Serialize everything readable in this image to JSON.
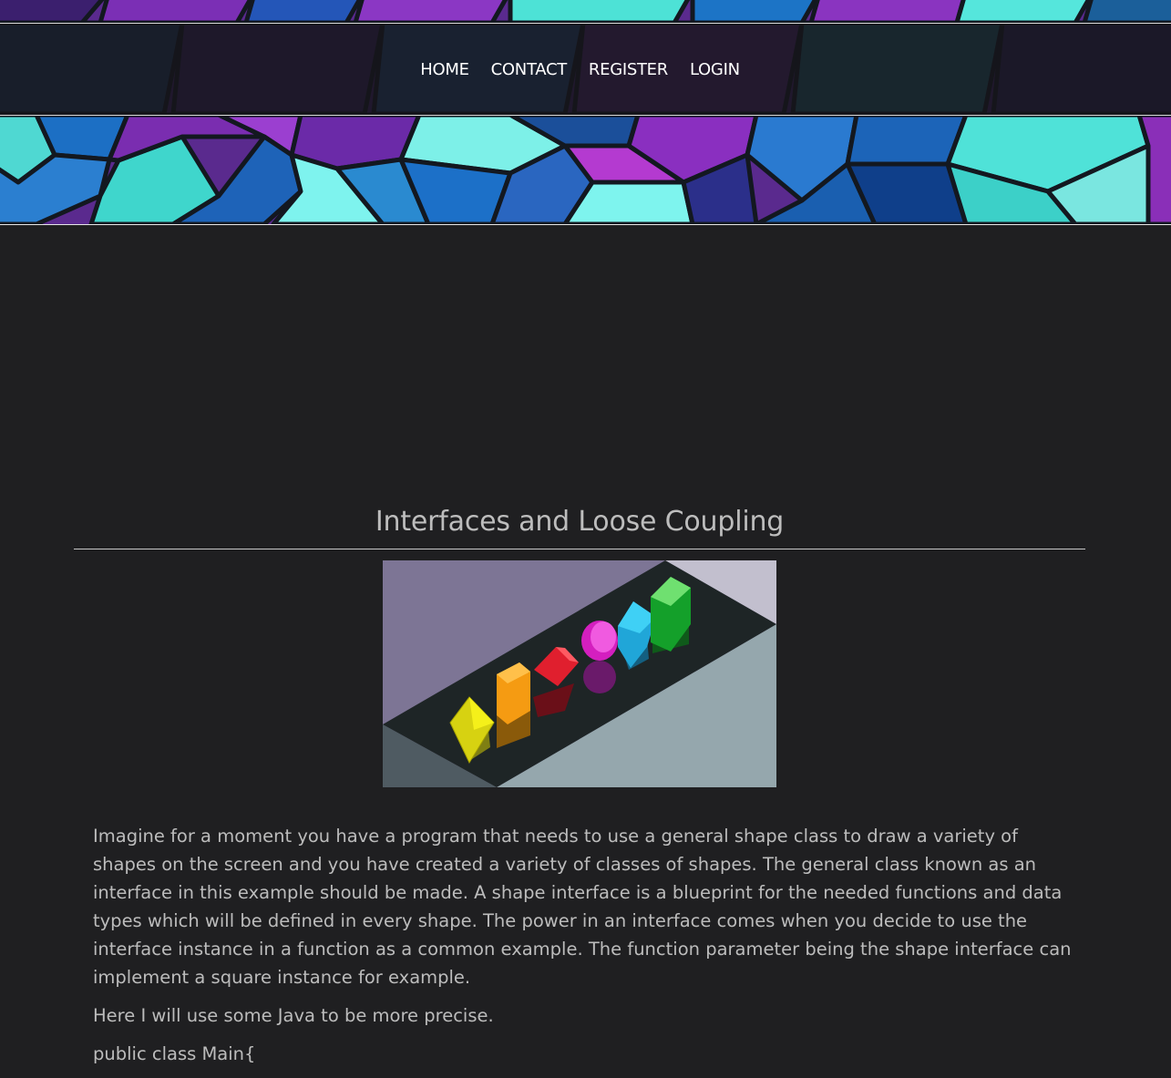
{
  "nav": {
    "items": [
      {
        "label": "HOME"
      },
      {
        "label": "CONTACT"
      },
      {
        "label": "REGISTER"
      },
      {
        "label": "LOGIN"
      }
    ]
  },
  "article": {
    "title": "Interfaces and Loose Coupling",
    "paragraphs": [
      " Imagine for a moment you have a program that needs to use a general shape class to draw a variety of shapes on the screen and you have created a variety of classes of shapes. The general class known as an interface in this example should be made. A shape interface is a blueprint for the needed functions and data types which will be defined in every shape. The power in an interface comes when you decide to use the interface instance in a function as a common example. The function parameter being the shape interface can implement a square instance for example.",
      " Here I will use some Java to be more precise.",
      " public class Main{"
    ]
  },
  "colors": {
    "background": "#1f1f21",
    "text": "#bcbcbc",
    "nav_text": "#ffffff",
    "cube_cyan": "#4fe0d8",
    "cube_blue": "#1a6fc0",
    "cube_purple": "#8a2fb8"
  }
}
